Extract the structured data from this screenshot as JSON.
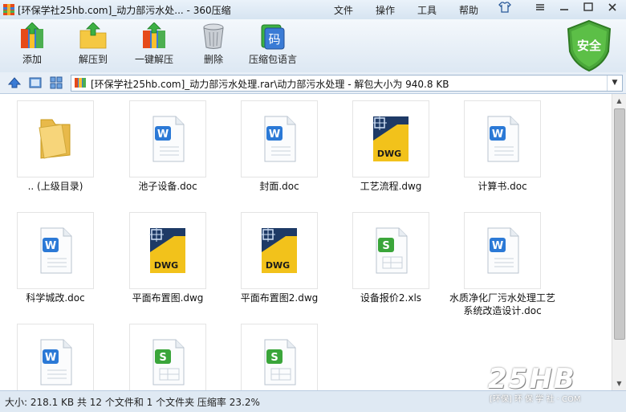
{
  "window": {
    "title": "[环保学社25hb.com]_动力部污水处...  - 360压缩",
    "menu": [
      "文件",
      "操作",
      "工具",
      "帮助"
    ]
  },
  "toolbar": {
    "buttons": [
      {
        "label": "添加",
        "icon": "add-archive-icon"
      },
      {
        "label": "解压到",
        "icon": "extract-to-icon"
      },
      {
        "label": "一键解压",
        "icon": "one-click-extract-icon"
      },
      {
        "label": "删除",
        "icon": "delete-trash-icon"
      },
      {
        "label": "压缩包语言",
        "icon": "archive-language-icon",
        "badge": "码"
      }
    ],
    "security_badge": "安全"
  },
  "address": {
    "path": "[环保学社25hb.com]_动力部污水处理.rar\\动力部污水处理 - 解包大小为 940.8 KB"
  },
  "files": [
    {
      "name": ".. (上级目录)",
      "type": "folder"
    },
    {
      "name": "池子设备.doc",
      "type": "doc"
    },
    {
      "name": "封面.doc",
      "type": "doc"
    },
    {
      "name": "工艺流程.dwg",
      "type": "dwg"
    },
    {
      "name": "计算书.doc",
      "type": "doc"
    },
    {
      "name": "科学城改.doc",
      "type": "doc"
    },
    {
      "name": "平面布置图.dwg",
      "type": "dwg"
    },
    {
      "name": "平面布置图2.dwg",
      "type": "dwg"
    },
    {
      "name": "设备报价2.xls",
      "type": "xls"
    },
    {
      "name": "水质净化厂污水处理工艺系统改造设计.doc",
      "name_lines": [
        "水质净化厂污水处理工艺",
        "系统改造设计.doc"
      ],
      "type": "doc"
    },
    {
      "name": "",
      "type": "doc"
    },
    {
      "name": "",
      "type": "xls"
    },
    {
      "name": "",
      "type": "xls"
    }
  ],
  "status": {
    "text": "大小: 218.1 KB 共 12 个文件和 1 个文件夹 压缩率 23.2%"
  },
  "watermark": {
    "big": "25HB",
    "small": "[环保] 环 保 学 社 · COM"
  },
  "colors": {
    "doc_blue": "#2b79d6",
    "xls_green": "#3aa53a",
    "dwg_yellow": "#f2c21b",
    "dwg_navy": "#1e3a66",
    "shield_green": "#4aa63a"
  }
}
